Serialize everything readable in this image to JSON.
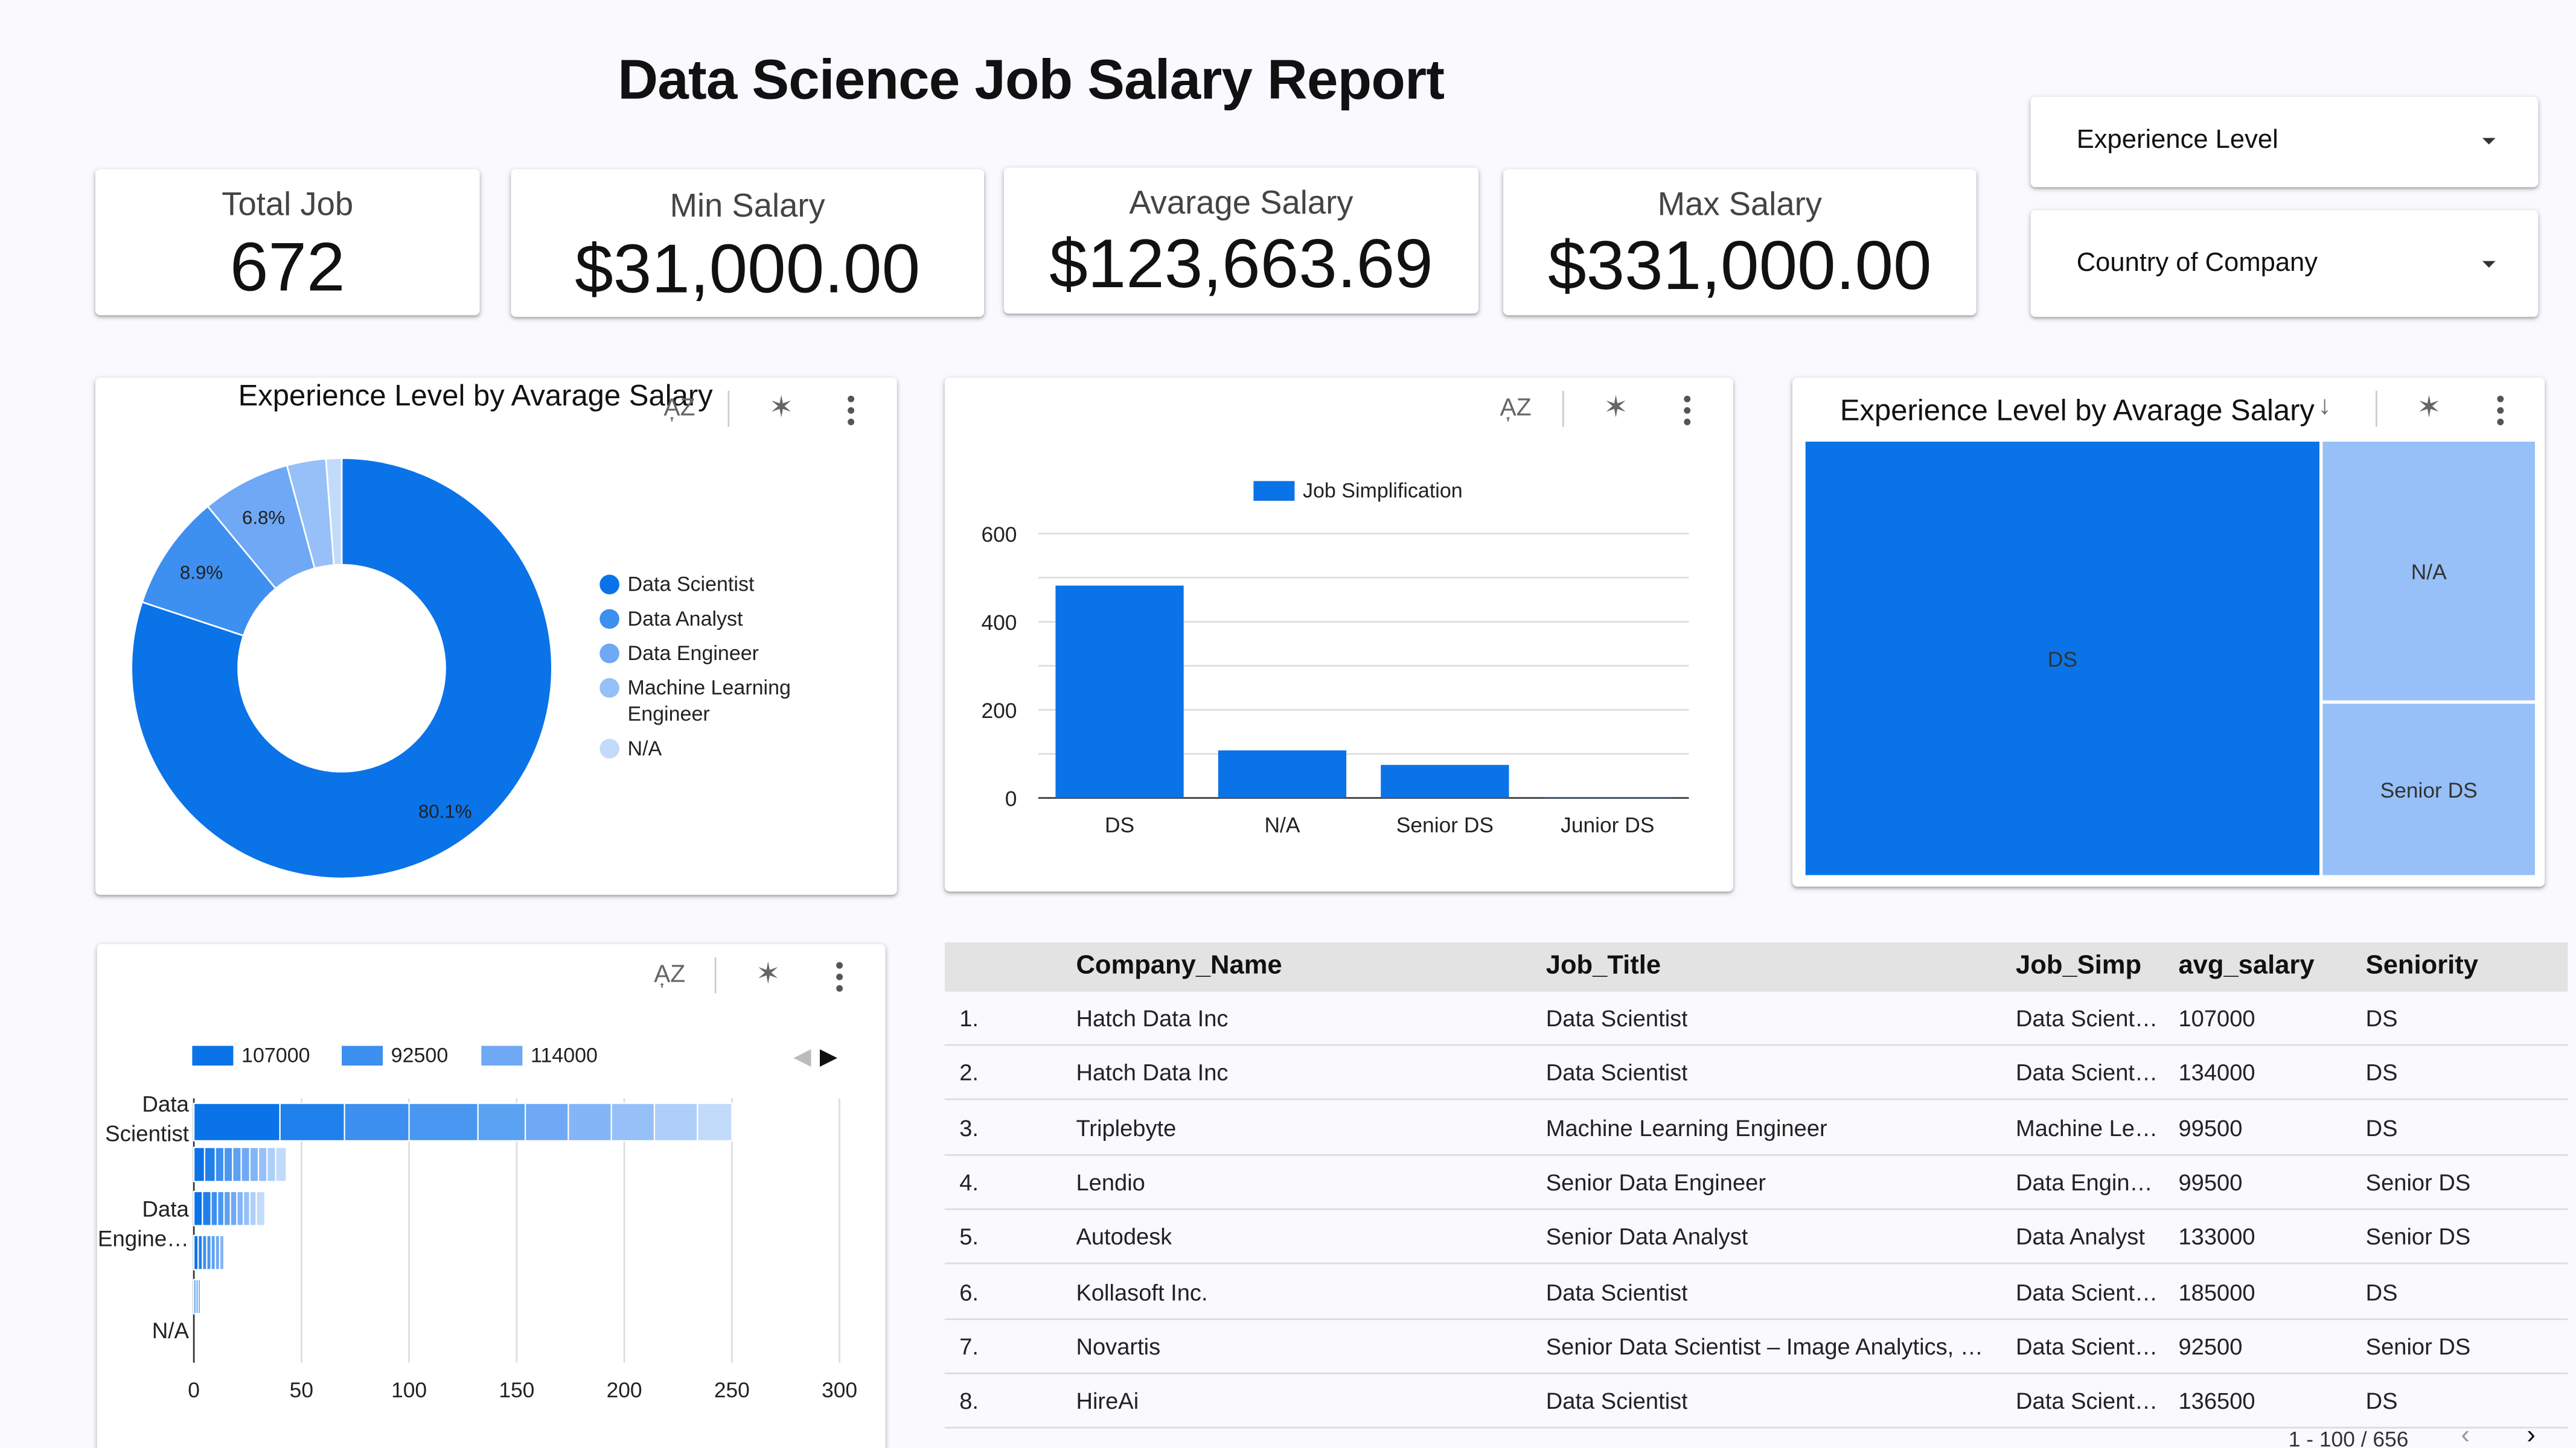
{
  "report": {
    "title": "Data Science Job Salary Report"
  },
  "kpis": [
    {
      "label": "Total Job",
      "value": "672"
    },
    {
      "label": "Min Salary",
      "value": "$31,000.00"
    },
    {
      "label": "Avarage Salary",
      "value": "$123,663.69"
    },
    {
      "label": "Max Salary",
      "value": "$331,000.00"
    }
  ],
  "filters": [
    {
      "label": "Experience Level",
      "icon": "dropdown-caret-icon"
    },
    {
      "label": "Country of Company",
      "icon": "dropdown-caret-icon"
    }
  ],
  "toolbar": {
    "sort_icon": "sort-az-icon",
    "drill_icon": "drill-cross-filter-icon",
    "menu_icon": "more-vert-icon",
    "sort_symbol": "A͎Z",
    "drill_symbol": "✶"
  },
  "colors": {
    "primary": "#0a73e8",
    "mid": "#3d8ff0",
    "light": "#6fa8f5",
    "lighter": "#96c0f7",
    "lightest": "#c2dbfa"
  },
  "donut": {
    "title": "Experience Level by Avarage Salary",
    "legend": [
      "Data Scientist",
      "Data Analyst",
      "Data Engineer",
      "Machine Learning Engineer",
      "N/A"
    ],
    "legend_lines": [
      [
        "Data Scientist"
      ],
      [
        "Data Analyst"
      ],
      [
        "Data Engineer"
      ],
      [
        "Machine Learning",
        "Engineer"
      ],
      [
        "N/A"
      ]
    ]
  },
  "bar": {
    "legend": "Job Simplification"
  },
  "treemap": {
    "title": "Experience Level by Avarage Salary"
  },
  "hbar": {
    "legend": [
      "107000",
      "92500",
      "114000"
    ],
    "categories": [
      "Data Scientist",
      "Data Engine…",
      "N/A"
    ]
  },
  "chart_data": [
    {
      "type": "pie",
      "title": "Experience Level by Avarage Salary",
      "labels": [
        "Data Scientist",
        "Data Analyst",
        "Data Engineer",
        "Machine Learning Engineer",
        "N/A"
      ],
      "values": [
        80.1,
        8.9,
        6.8,
        3.0,
        1.2
      ],
      "value_labels": [
        "80.1%",
        "8.9%",
        "6.8%",
        "",
        ""
      ],
      "legend_position": "right",
      "donut": true
    },
    {
      "type": "bar",
      "title": "",
      "categories": [
        "DS",
        "N/A",
        "Senior DS",
        "Junior DS"
      ],
      "series": [
        {
          "name": "Job Simplification",
          "values": [
            482,
            108,
            75,
            2
          ]
        }
      ],
      "ylim": [
        0,
        600
      ],
      "yticks": [
        0,
        200,
        400,
        600
      ],
      "grid": true,
      "legend_position": "top"
    },
    {
      "type": "treemap",
      "title": "Experience Level by Avarage Salary",
      "labels": [
        "DS",
        "N/A",
        "Senior DS"
      ],
      "values": [
        480,
        120,
        80
      ]
    },
    {
      "type": "bar",
      "orientation": "horizontal",
      "stacked": true,
      "title": "",
      "categories": [
        "Data Scientist",
        "",
        "Data Engine…",
        "",
        "N/A",
        ""
      ],
      "segments": [
        [
          40,
          30,
          30,
          32,
          22,
          20,
          20,
          20,
          20,
          16
        ],
        [
          5,
          5,
          4,
          4,
          4,
          4,
          4,
          4,
          4,
          5
        ],
        [
          4,
          4,
          3,
          3,
          3,
          3,
          3,
          3,
          3,
          4
        ],
        [
          2,
          2,
          2,
          2,
          2,
          2,
          2
        ],
        [
          1,
          1,
          1
        ],
        []
      ],
      "series": [
        {
          "name": "107000"
        },
        {
          "name": "92500"
        },
        {
          "name": "114000"
        }
      ],
      "xlim": [
        0,
        300
      ],
      "xticks": [
        0,
        50,
        100,
        150,
        200,
        250,
        300
      ],
      "grid": true,
      "legend_position": "top"
    }
  ],
  "table": {
    "columns": [
      "",
      "Company_Name",
      "Job_Title",
      "Job_Simp",
      "avg_salary",
      "Seniority"
    ],
    "rows": [
      [
        "1.",
        "Hatch Data Inc",
        "Data Scientist",
        "Data Scient…",
        "107000",
        "DS"
      ],
      [
        "2.",
        "Hatch Data Inc",
        "Data Scientist",
        "Data Scient…",
        "134000",
        "DS"
      ],
      [
        "3.",
        "Triplebyte",
        "Machine Learning Engineer",
        "Machine Le…",
        "99500",
        "DS"
      ],
      [
        "4.",
        "Lendio",
        "Senior Data Engineer",
        "Data Engin…",
        "99500",
        "Senior DS"
      ],
      [
        "5.",
        "Autodesk",
        "Senior Data Analyst",
        "Data Analyst",
        "133000",
        "Senior DS"
      ],
      [
        "6.",
        "Kollasoft Inc.",
        "Data Scientist",
        "Data Scient…",
        "185000",
        "DS"
      ],
      [
        "7.",
        "Novartis",
        "Senior Data Scientist – Image Analytics, …",
        "Data Scient…",
        "92500",
        "Senior DS"
      ],
      [
        "8.",
        "HireAi",
        "Data Scientist",
        "Data Scient…",
        "136500",
        "DS"
      ]
    ],
    "pagination": "1 - 100 / 656"
  }
}
